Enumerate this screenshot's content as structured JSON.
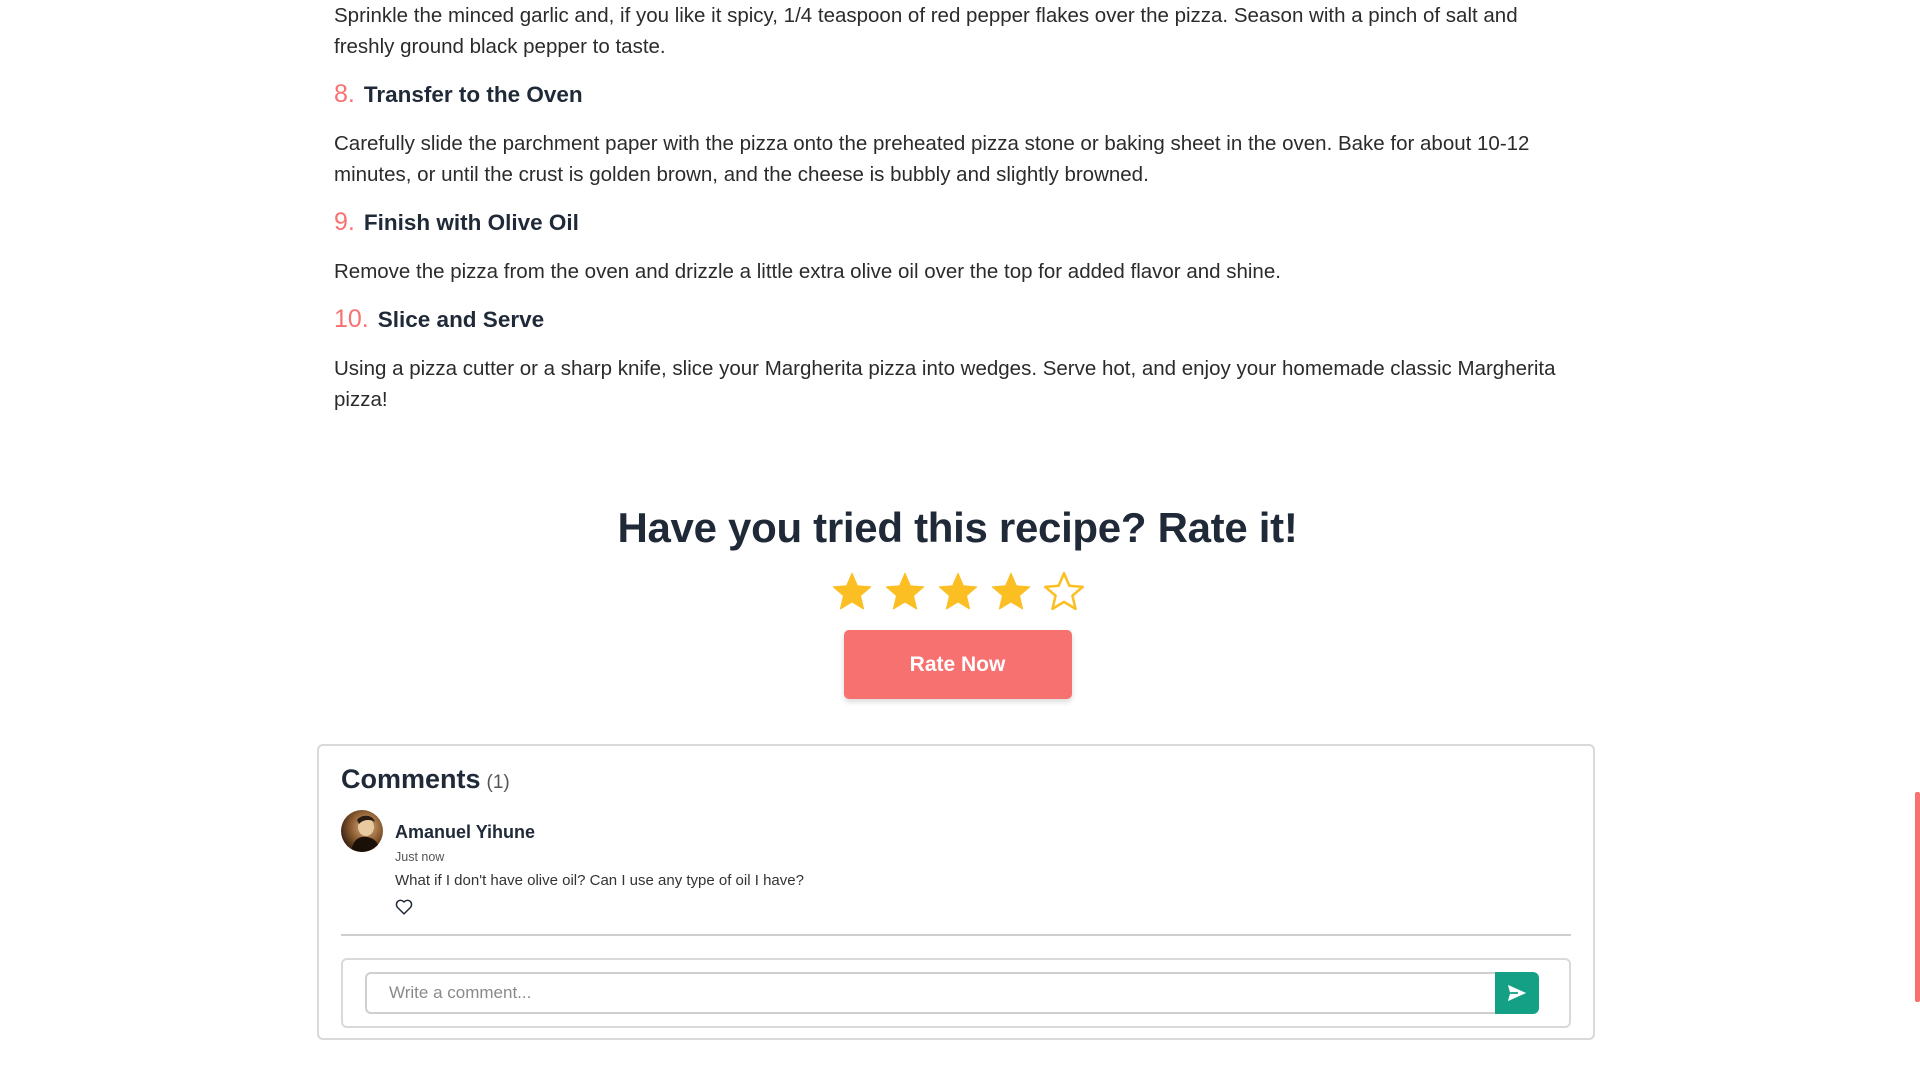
{
  "steps": {
    "step7_text": "Sprinkle the minced garlic and, if you like it spicy, 1/4 teaspoon of red pepper flakes over the pizza. Season with a pinch of salt and freshly ground black pepper to taste.",
    "items": [
      {
        "number": "8.",
        "title": "Transfer to the Oven",
        "text": "Carefully slide the parchment paper with the pizza onto the preheated pizza stone or baking sheet in the oven. Bake for about 10-12 minutes, or until the crust is golden brown, and the cheese is bubbly and slightly browned."
      },
      {
        "number": "9.",
        "title": "Finish with Olive Oil",
        "text": "Remove the pizza from the oven and drizzle a little extra olive oil over the top for added flavor and shine."
      },
      {
        "number": "10.",
        "title": "Slice and Serve",
        "text": "Using a pizza cutter or a sharp knife, slice your Margherita pizza into wedges. Serve hot, and enjoy your homemade classic Margherita pizza!"
      }
    ]
  },
  "rating": {
    "title": "Have you tried this recipe? Rate it!",
    "value": 4,
    "max": 5,
    "star_color": "#fbbf24",
    "button_label": "Rate Now",
    "button_color": "#f87171"
  },
  "comments": {
    "title": "Comments",
    "count": "(1)",
    "items": [
      {
        "author": "Amanuel Yihune",
        "time": "Just now",
        "text": "What if I don't have olive oil? Can I use any type of oil I have?",
        "like_icon": "heart-outline-icon"
      }
    ],
    "input_placeholder": "Write a comment...",
    "send_icon": "send-icon",
    "send_color": "#14a085"
  }
}
